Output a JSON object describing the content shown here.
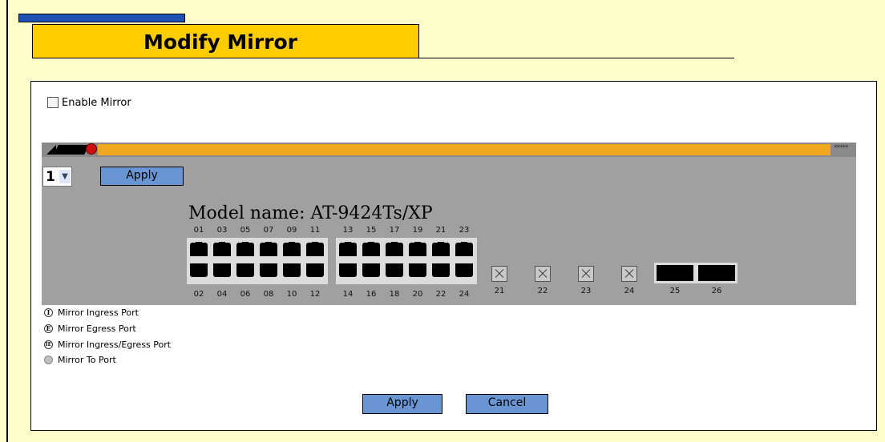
{
  "page": {
    "title": "Modify Mirror"
  },
  "enable_mirror": {
    "label": "Enable Mirror",
    "checked": false
  },
  "device": {
    "unit_selected": "1",
    "apply_label": "Apply",
    "model_name": "Model name: AT-9424Ts/XP",
    "stars": "*****",
    "top_port_numbers": [
      "01",
      "03",
      "05",
      "07",
      "09",
      "11",
      "13",
      "15",
      "17",
      "19",
      "21",
      "23"
    ],
    "bottom_port_numbers": [
      "02",
      "04",
      "06",
      "08",
      "10",
      "12",
      "14",
      "16",
      "18",
      "20",
      "22",
      "24"
    ],
    "gbic_port_numbers": [
      "21",
      "22",
      "23",
      "24"
    ],
    "sfp_port_numbers": [
      "25",
      "26"
    ]
  },
  "legend": {
    "ingress": "Mirror Ingress Port",
    "egress": "Mirror Egress Port",
    "ingress_egress": "Mirror Ingress/Egress Port",
    "to_port": "Mirror To Port",
    "ingress_symbol": "I",
    "egress_symbol": "E",
    "ingress_egress_symbol": "IE"
  },
  "footer": {
    "apply_label": "Apply",
    "cancel_label": "Cancel"
  },
  "colors": {
    "accent_blue": "#6996d2",
    "title_yellow": "#ffcc00",
    "page_bg": "#ffffcc"
  }
}
